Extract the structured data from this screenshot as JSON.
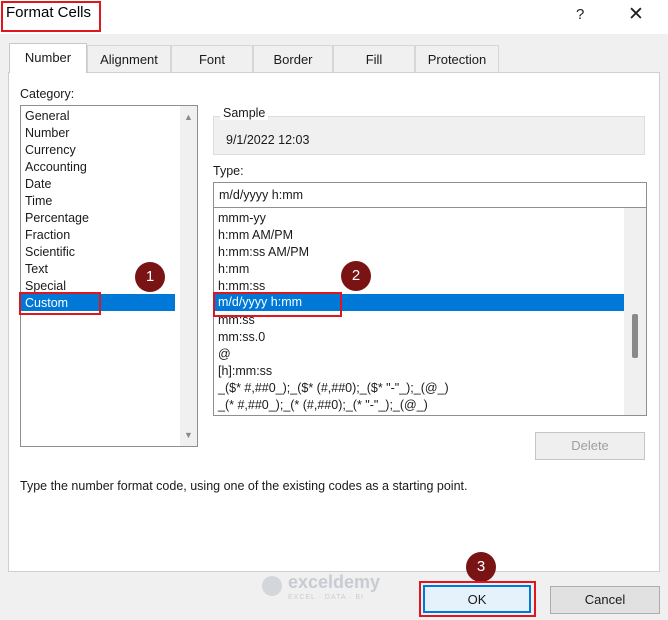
{
  "window": {
    "title": "Format Cells",
    "help_icon": "?",
    "close_icon": "✕"
  },
  "tabs": [
    {
      "label": "Number"
    },
    {
      "label": "Alignment"
    },
    {
      "label": "Font"
    },
    {
      "label": "Border"
    },
    {
      "label": "Fill"
    },
    {
      "label": "Protection"
    }
  ],
  "category": {
    "label": "Category:",
    "items": [
      "General",
      "Number",
      "Currency",
      "Accounting",
      "Date",
      "Time",
      "Percentage",
      "Fraction",
      "Scientific",
      "Text",
      "Special",
      "Custom"
    ],
    "selected": "Custom"
  },
  "sample": {
    "label": "Sample",
    "value": "9/1/2022 12:03"
  },
  "type": {
    "label": "Type:",
    "value": "m/d/yyyy h:mm",
    "formats": [
      "mmm-yy",
      "h:mm AM/PM",
      "h:mm:ss AM/PM",
      "h:mm",
      "h:mm:ss",
      "m/d/yyyy h:mm",
      "mm:ss",
      "mm:ss.0",
      "@",
      "[h]:mm:ss",
      "_($* #,##0_);_($* (#,##0);_($* \"-\"_);_(@_)",
      "_(* #,##0_);_(* (#,##0);_(* \"-\"_);_(@_)"
    ],
    "selected": "m/d/yyyy h:mm"
  },
  "buttons": {
    "delete": "Delete",
    "ok": "OK",
    "cancel": "Cancel"
  },
  "description": "Type the number format code, using one of the existing codes as a starting point.",
  "badges": [
    "1",
    "2",
    "3"
  ],
  "watermark": {
    "name": "exceldemy",
    "tagline": "EXCEL · DATA · BI"
  },
  "colors": {
    "selection": "#0078d7",
    "highlight": "#e0161e",
    "badge": "#7a1414"
  }
}
